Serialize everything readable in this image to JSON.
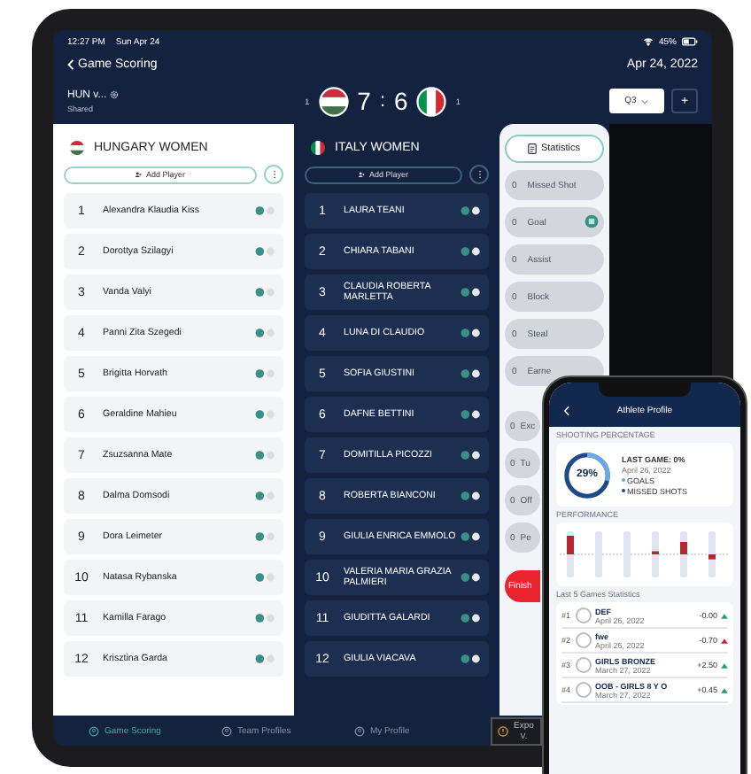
{
  "status_bar": {
    "time": "12:27 PM",
    "date": "Sun Apr 24",
    "battery": "45%"
  },
  "nav": {
    "back": "Game Scoring",
    "date": "Apr 24, 2022"
  },
  "game": {
    "name": "HUN v...",
    "sharing": "Shared",
    "home_timeouts": "1",
    "away_timeouts": "1",
    "home_score": "7",
    "separator": ":",
    "away_score": "6",
    "period": "Q3",
    "add": "+"
  },
  "teams": [
    {
      "name": "HUNGARY WOMEN",
      "add_player": "Add Player",
      "players": [
        {
          "number": "1",
          "name": "Alexandra Klaudia Kiss"
        },
        {
          "number": "2",
          "name": "Dorottya Szilagyi"
        },
        {
          "number": "3",
          "name": "Vanda Valyi"
        },
        {
          "number": "4",
          "name": "Panni Zita Szegedi"
        },
        {
          "number": "5",
          "name": "Brigitta Horvath"
        },
        {
          "number": "6",
          "name": "Geraldine Mahieu"
        },
        {
          "number": "7",
          "name": "Zsuzsanna Mate"
        },
        {
          "number": "8",
          "name": "Dalma Domsodi"
        },
        {
          "number": "9",
          "name": "Dora Leimeter"
        },
        {
          "number": "10",
          "name": "Natasa Rybanska"
        },
        {
          "number": "11",
          "name": "Kamilla Farago"
        },
        {
          "number": "12",
          "name": "Krisztina Garda"
        }
      ]
    },
    {
      "name": "ITALY WOMEN",
      "add_player": "Add Player",
      "players": [
        {
          "number": "1",
          "name": "LAURA TEANI"
        },
        {
          "number": "2",
          "name": "CHIARA TABANI"
        },
        {
          "number": "3",
          "name": "CLAUDIA ROBERTA MARLETTA"
        },
        {
          "number": "4",
          "name": "LUNA DI CLAUDIO"
        },
        {
          "number": "5",
          "name": "SOFIA GIUSTINI"
        },
        {
          "number": "6",
          "name": "DAFNE BETTINI"
        },
        {
          "number": "7",
          "name": "DOMITILLA PICOZZI"
        },
        {
          "number": "8",
          "name": "ROBERTA BIANCONI"
        },
        {
          "number": "9",
          "name": "GIULIA ENRICA EMMOLO"
        },
        {
          "number": "10",
          "name": "VALERIA MARIA GRAZIA PALMIERI"
        },
        {
          "number": "11",
          "name": "GIUDITTA GALARDI"
        },
        {
          "number": "12",
          "name": "GIULIA VIACAVA"
        }
      ]
    }
  ],
  "statistics": {
    "button": "Statistics",
    "actions": [
      {
        "count": "0",
        "label": "Missed Shot",
        "highlighted": false
      },
      {
        "count": "0",
        "label": "Goal",
        "highlighted": true
      },
      {
        "count": "0",
        "label": "Assist",
        "highlighted": false
      },
      {
        "count": "0",
        "label": "Block",
        "highlighted": false
      },
      {
        "count": "0",
        "label": "Steal",
        "highlighted": false
      },
      {
        "count": "0",
        "label": "Earne",
        "highlighted": false
      },
      {
        "count": "0",
        "label": "Exc",
        "highlighted": false
      },
      {
        "count": "0",
        "label": "Tu",
        "highlighted": false
      },
      {
        "count": "0",
        "label": "Off",
        "highlighted": false
      },
      {
        "count": "0",
        "label": "Pe",
        "highlighted": false
      }
    ],
    "finish": "Finish"
  },
  "tabs": [
    {
      "label": "Game Scoring",
      "selected": true
    },
    {
      "label": "Team Profiles",
      "selected": false
    },
    {
      "label": "My Profile",
      "selected": false
    }
  ],
  "export": {
    "label": "Expo",
    "sub": "V."
  },
  "phone": {
    "title": "Athlete Profile",
    "shooting_heading": "SHOOTING PERCENTAGE",
    "percent": "29%",
    "level": 0.29,
    "last_game": "LAST GAME: 0%",
    "last_game_date": "April 26, 2022",
    "legend": [
      "GOALS",
      "MISSED SHOTS"
    ],
    "performance_heading": "PERFORMANCE",
    "games_heading": "Last 5 Games Statistics",
    "games": [
      {
        "rank": "#1",
        "title": "DEF",
        "date": "April 26, 2022",
        "delta": "-0.00",
        "color": "#2e9b6e"
      },
      {
        "rank": "#2",
        "title": "fwe",
        "date": "April 26, 2022",
        "delta": "-0.70",
        "color": "#c8283a"
      },
      {
        "rank": "#3",
        "title": "GIRLS BRONZE",
        "date": "March 27, 2022",
        "delta": "+2.50",
        "color": "#2e9b6e"
      },
      {
        "rank": "#4",
        "title": "OOB - GIRLS 8 Y O",
        "date": "March 27, 2022",
        "delta": "+0.45",
        "color": "#2e9b6e"
      }
    ]
  }
}
